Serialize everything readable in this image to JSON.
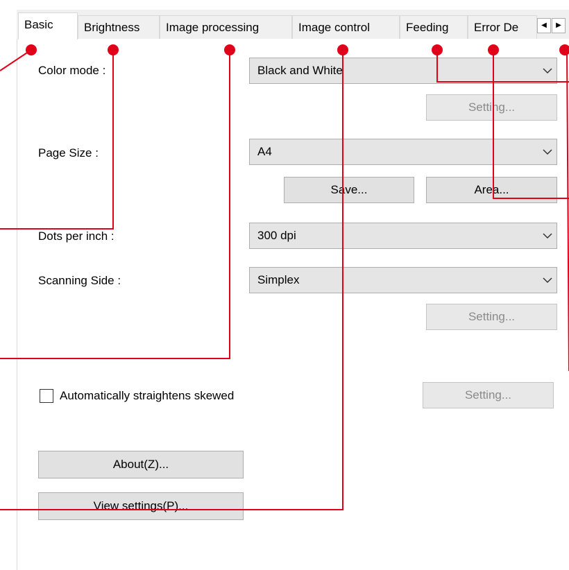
{
  "tabs": [
    {
      "label": "Basic",
      "active": true
    },
    {
      "label": "Brightness"
    },
    {
      "label": "Image processing"
    },
    {
      "label": "Image control"
    },
    {
      "label": "Feeding"
    },
    {
      "label": "Error De"
    }
  ],
  "tab_scroll": {
    "left_icon": "arrow-left-icon",
    "right_icon": "arrow-right-icon"
  },
  "basic": {
    "color_mode_label": "Color mode :",
    "color_mode_value": "Black and White",
    "color_setting_button": "Setting...",
    "page_size_label": "Page Size :",
    "page_size_value": "A4",
    "save_button": "Save...",
    "area_button": "Area...",
    "dpi_label": "Dots per inch :",
    "dpi_value": "300 dpi",
    "side_label": "Scanning Side :",
    "side_value": "Simplex",
    "side_setting_button": "Setting...",
    "deskew_label": "Automatically straightens skewed",
    "deskew_checked": false,
    "deskew_setting_button": "Setting...",
    "about_button": "About(Z)...",
    "view_settings_button": "View settings(P)..."
  },
  "colors": {
    "annotation": "#e0001a",
    "tab_bg": "#f0f0f0",
    "button_bg": "#e1e1e1",
    "disabled_text": "#8a8a8a"
  }
}
